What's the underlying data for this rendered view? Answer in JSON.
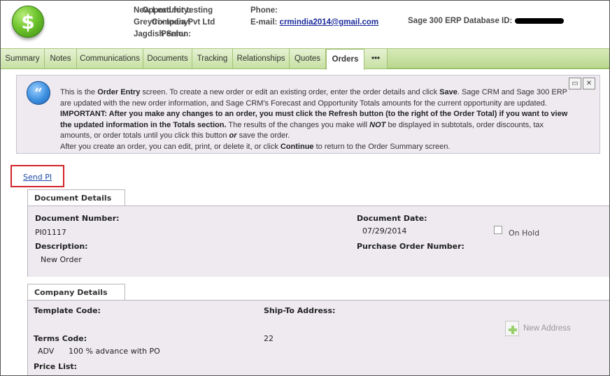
{
  "header": {
    "opportunity_label": "Opportunity:",
    "opportunity_value": "New Lead for testing",
    "company_label": "Company:",
    "company_value": "Greytrix India Pvt Ltd",
    "person_label": "Person:",
    "person_value": "Jagdish Sahu",
    "phone_label": "Phone:",
    "email_label": "E-mail:",
    "email_value": "crmindia2014@gmail.com",
    "erp_label": "Sage 300 ERP Database ID:"
  },
  "tabs": [
    {
      "label": "Summary"
    },
    {
      "label": "Notes"
    },
    {
      "label": "Communications"
    },
    {
      "label": "Documents"
    },
    {
      "label": "Tracking"
    },
    {
      "label": "Relationships"
    },
    {
      "label": "Quotes"
    },
    {
      "label": "Orders",
      "active": true
    },
    {
      "label": "•••"
    }
  ],
  "info": {
    "line1_a": "This is the ",
    "line1_b": "Order Entry",
    "line1_c": " screen. To create a new order or edit an existing order, enter the order details and click ",
    "line1_d": "Save",
    "line1_e": ". Sage CRM and Sage 300 ERP are updated with the new order information, and Sage CRM's Forecast and Opportunity Totals amounts for the current opportunity are updated.",
    "important": "IMPORTANT: After you make any changes to an order, you must click the Refresh button (to the right of the Order Total) if you want to view the updated information in the Totals section.",
    "line3_a": " The results of the changes you make will ",
    "line3_not": "NOT",
    "line3_b": " be displayed in subtotals, order discounts, tax amounts, or order totals until you click this button ",
    "line3_or": "or",
    "line3_c": " save the order.",
    "line4_a": "After you create an order, you can edit, print, or delete it, or click ",
    "line4_continue": "Continue",
    "line4_b": " to return to the Order Summary screen."
  },
  "send_pi": "Send PI",
  "document_details": {
    "title": "Document Details",
    "doc_number_label": "Document Number:",
    "doc_number": "PI01117",
    "doc_date_label": "Document Date:",
    "doc_date": "07/29/2014",
    "on_hold_label": "On Hold",
    "description_label": "Description:",
    "description": "New Order",
    "po_number_label": "Purchase Order Number:"
  },
  "company_details": {
    "title": "Company Details",
    "template_code_label": "Template Code:",
    "ship_to_label": "Ship-To Address:",
    "new_address_label": "New Address",
    "terms_code_label": "Terms Code:",
    "terms_code": "ADV",
    "terms_desc": "100 % advance with PO",
    "ship_to_value": "22",
    "price_list_label": "Price List:"
  }
}
